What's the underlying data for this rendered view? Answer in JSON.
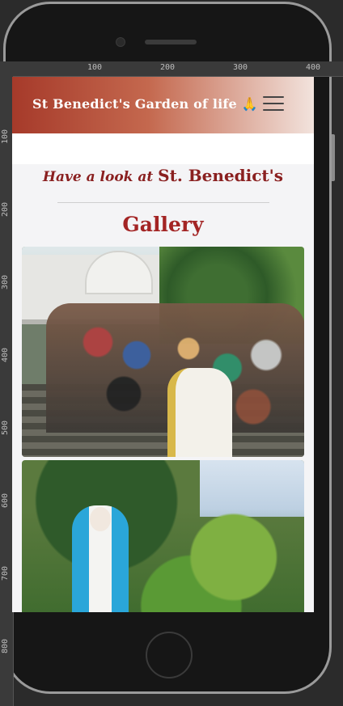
{
  "ruler": {
    "top_labels": [
      "100",
      "200",
      "300",
      "400"
    ],
    "left_labels": [
      "100",
      "200",
      "300",
      "400",
      "500",
      "600",
      "700",
      "800"
    ]
  },
  "navbar": {
    "brand": "St Benedict's Garden of life",
    "brand_icon": "praying-hands-icon",
    "menu_icon": "hamburger-menu-icon"
  },
  "section": {
    "lead": "Have a look at",
    "name": "St. Benedict's",
    "title": "Gallery"
  },
  "gallery": {
    "photos": [
      {
        "subject": "group-photo"
      },
      {
        "subject": "marian-statue-garden"
      }
    ]
  },
  "colors": {
    "brand_red": "#a32424",
    "navbar_start": "#a63a2a",
    "navbar_end": "#f2e3dd"
  }
}
